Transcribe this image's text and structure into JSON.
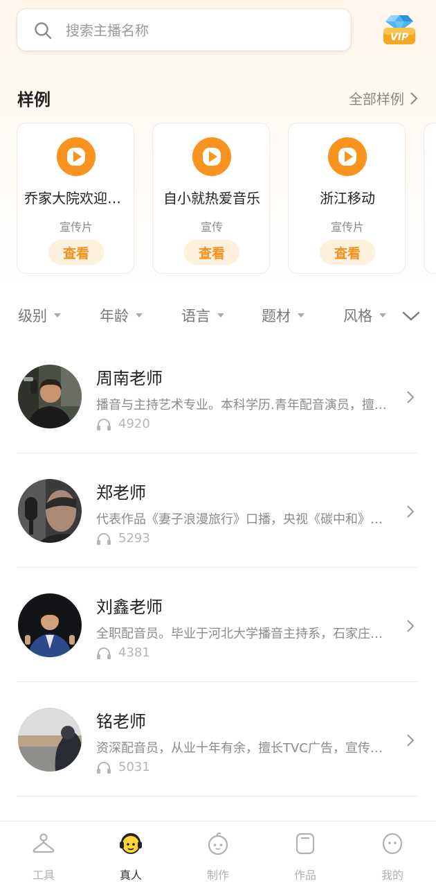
{
  "search": {
    "placeholder": "搜索主播名称"
  },
  "vip_badge": {
    "label": "VIP",
    "icon": "diamond-vip-icon"
  },
  "samples": {
    "title": "样例",
    "more_label": "全部样例",
    "items": [
      {
        "title": "乔家大院欢迎光临",
        "type": "宣传片",
        "button": "查看"
      },
      {
        "title": "自小就热爱音乐",
        "type": "宣传",
        "button": "查看"
      },
      {
        "title": "浙江移动",
        "type": "宣传片",
        "button": "查看"
      }
    ]
  },
  "filters": [
    {
      "label": "级别"
    },
    {
      "label": "年龄"
    },
    {
      "label": "语言"
    },
    {
      "label": "题材"
    },
    {
      "label": "风格"
    }
  ],
  "teachers": [
    {
      "name": "周南老师",
      "desc": "播音与主持艺术专业。本科学历.青年配音演员，擅长广告宣传片配音",
      "plays": "4920"
    },
    {
      "name": "郑老师",
      "desc": "代表作品《妻子浪漫旅行》口播，央视《碳中和》纪录片",
      "plays": "5293"
    },
    {
      "name": "刘鑫老师",
      "desc": "全职配音员。毕业于河北大学播音主持系，石家庄电台主播",
      "plays": "4381"
    },
    {
      "name": "铭老师",
      "desc": "资深配音员，从业十年有余，擅长TVC广告，宣传片配音",
      "plays": "5031"
    }
  ],
  "tabbar": [
    {
      "label": "工具",
      "icon": "hanger-icon",
      "active": false
    },
    {
      "label": "真人",
      "icon": "headphone-face-icon",
      "active": true
    },
    {
      "label": "制作",
      "icon": "make-face-icon",
      "active": false
    },
    {
      "label": "作品",
      "icon": "works-icon",
      "active": false
    },
    {
      "label": "我的",
      "icon": "profile-face-icon",
      "active": false
    }
  ],
  "colors": {
    "accent": "#f7931e",
    "accent_light": "#fdf0dd",
    "text": "#222222",
    "muted": "#8a8a8a"
  }
}
